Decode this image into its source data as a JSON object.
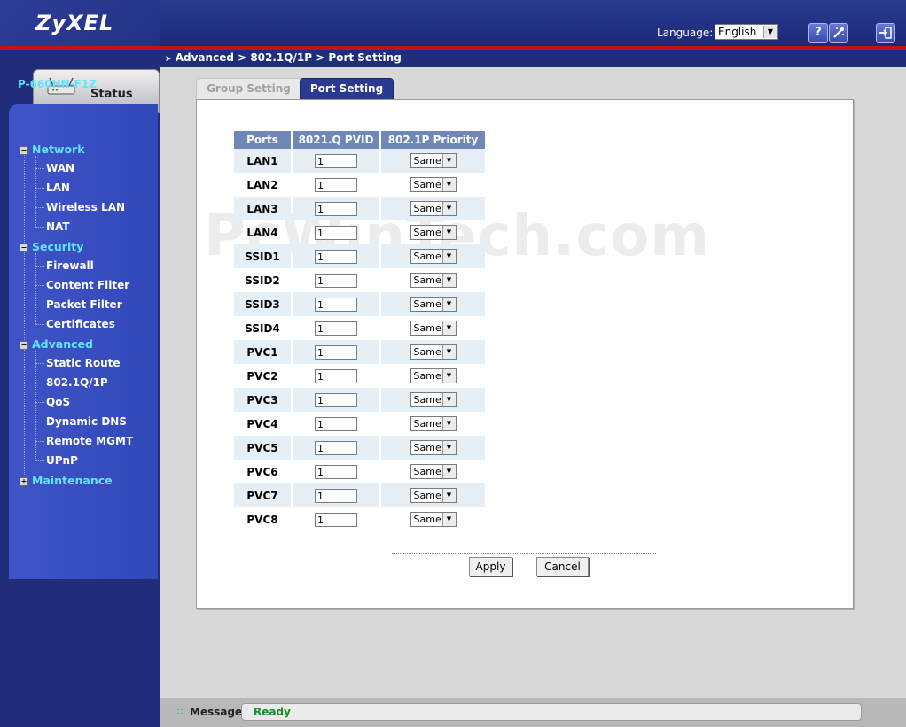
{
  "header": {
    "brand": "ZyXEL",
    "language_label": "Language:",
    "language_value": "English",
    "help_icon": "?"
  },
  "sidebar": {
    "status_label": "Status",
    "model": "P-660HN-F1Z",
    "groups": [
      {
        "label": "Network",
        "expanded": true,
        "items": [
          "WAN",
          "LAN",
          "Wireless LAN",
          "NAT"
        ]
      },
      {
        "label": "Security",
        "expanded": true,
        "items": [
          "Firewall",
          "Content Filter",
          "Packet Filter",
          "Certificates"
        ]
      },
      {
        "label": "Advanced",
        "expanded": true,
        "items": [
          "Static Route",
          "802.1Q/1P",
          "QoS",
          "Dynamic DNS",
          "Remote MGMT",
          "UPnP"
        ]
      },
      {
        "label": "Maintenance",
        "expanded": false,
        "items": []
      }
    ]
  },
  "breadcrumb": "Advanced > 802.1Q/1P > Port Setting",
  "tabs": [
    {
      "label": "Group Setting",
      "active": false
    },
    {
      "label": "Port Setting",
      "active": true
    }
  ],
  "table": {
    "headers": [
      "Ports",
      "8021.Q PVID",
      "802.1P Priority"
    ],
    "rows": [
      {
        "port": "LAN1",
        "pvid": "1",
        "priority": "Same"
      },
      {
        "port": "LAN2",
        "pvid": "1",
        "priority": "Same"
      },
      {
        "port": "LAN3",
        "pvid": "1",
        "priority": "Same"
      },
      {
        "port": "LAN4",
        "pvid": "1",
        "priority": "Same"
      },
      {
        "port": "SSID1",
        "pvid": "1",
        "priority": "Same"
      },
      {
        "port": "SSID2",
        "pvid": "1",
        "priority": "Same"
      },
      {
        "port": "SSID3",
        "pvid": "1",
        "priority": "Same"
      },
      {
        "port": "SSID4",
        "pvid": "1",
        "priority": "Same"
      },
      {
        "port": "PVC1",
        "pvid": "1",
        "priority": "Same"
      },
      {
        "port": "PVC2",
        "pvid": "1",
        "priority": "Same"
      },
      {
        "port": "PVC3",
        "pvid": "1",
        "priority": "Same"
      },
      {
        "port": "PVC4",
        "pvid": "1",
        "priority": "Same"
      },
      {
        "port": "PVC5",
        "pvid": "1",
        "priority": "Same"
      },
      {
        "port": "PVC6",
        "pvid": "1",
        "priority": "Same"
      },
      {
        "port": "PVC7",
        "pvid": "1",
        "priority": "Same"
      },
      {
        "port": "PVC8",
        "pvid": "1",
        "priority": "Same"
      }
    ]
  },
  "buttons": {
    "apply": "Apply",
    "cancel": "Cancel"
  },
  "watermark": "PcWinTech.com",
  "message": {
    "label": "Message",
    "text": "Ready"
  },
  "colors": {
    "header_blue": "#1f2d7a",
    "accent_red": "#c0141a",
    "nav_cyan": "#5ee6ff",
    "ready_green": "#1a8a2a",
    "table_header": "#7088b8"
  }
}
